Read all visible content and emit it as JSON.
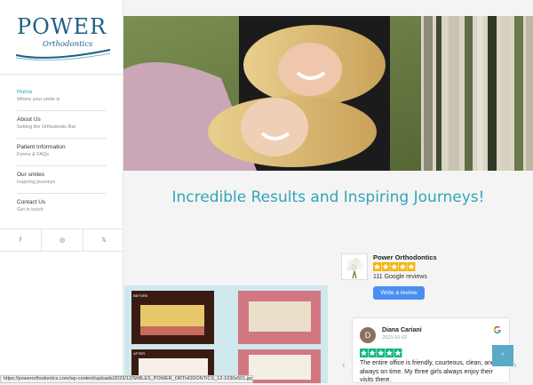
{
  "logo": {
    "brand": "POWER",
    "sub": "Orthodontics"
  },
  "nav": [
    {
      "title": "Home",
      "subtitle": "Where your smile is"
    },
    {
      "title": "About Us",
      "subtitle": "Setting the Orthodontic Bar"
    },
    {
      "title": "Patient Information",
      "subtitle": "Forms & FAQs"
    },
    {
      "title": "Our smiles",
      "subtitle": "Inspiring journeys"
    },
    {
      "title": "Contact Us",
      "subtitle": "Get in touch"
    }
  ],
  "social": {
    "facebook": "f",
    "instagram": "◎",
    "x": "𝕏"
  },
  "headline": "Incredible Results and Inspiring Journeys!",
  "before_after": {
    "before_label": "BEFORE",
    "after_label": "AFTER"
  },
  "google_summary": {
    "business": "Power Orthodontics",
    "rating_stars": 5,
    "count": "111 Google reviews",
    "button": "Write a review"
  },
  "review": {
    "initial": "D",
    "name": "Diana Cariani",
    "date": "2023-10-02",
    "rating_stars": 5,
    "text": "The entire office is friendly, courteous, clean, and always on time. My three girls always enjoy their visits there."
  },
  "carousel": {
    "prev": "‹",
    "next": "›"
  },
  "to_top": "^",
  "status_url": "https://powerorthodontics.com/wp-content/uploads/2023/12/SMILES_POWER_ORTHODONTICS_12-1030x501.jpg",
  "colors": {
    "accent": "#30a5b7",
    "star": "#f5b301",
    "button": "#4a8ff0"
  }
}
